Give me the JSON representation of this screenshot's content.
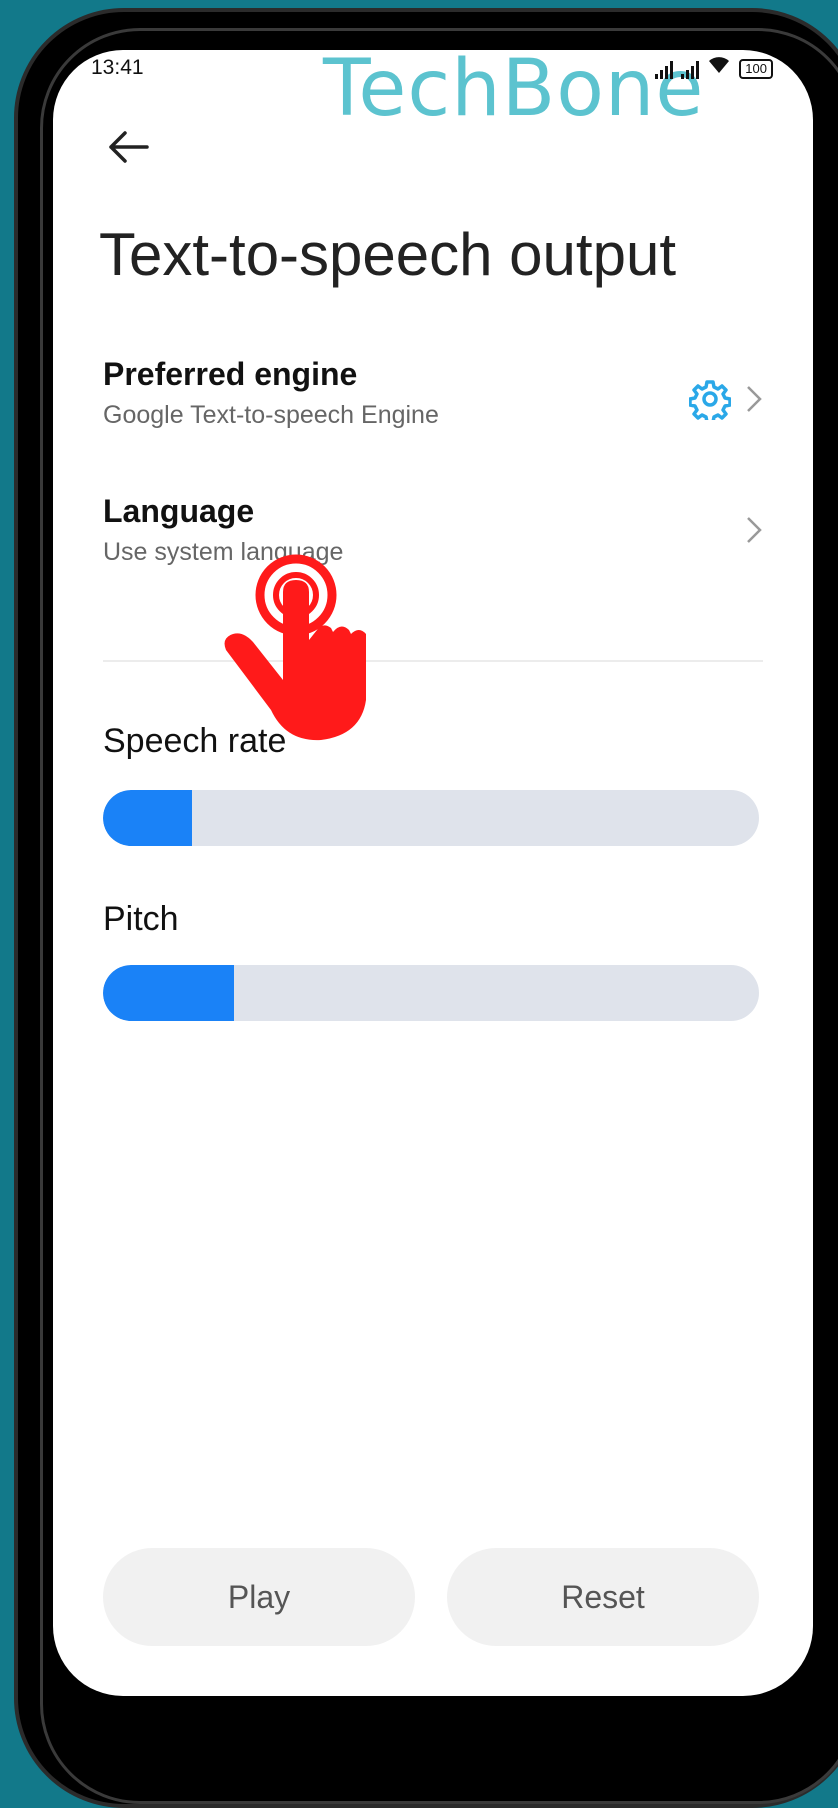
{
  "status_bar": {
    "time": "13:41",
    "battery": "100"
  },
  "watermark": "TechBone",
  "page": {
    "title": "Text-to-speech output"
  },
  "settings": [
    {
      "title": "Preferred engine",
      "subtitle": "Google Text-to-speech Engine"
    },
    {
      "title": "Language",
      "subtitle": "Use system language"
    }
  ],
  "speech_rate": {
    "label": "Speech rate",
    "value": 0.135
  },
  "pitch": {
    "label": "Pitch",
    "value": 0.2
  },
  "buttons": {
    "play": "Play",
    "reset": "Reset"
  },
  "colors": {
    "accent": "#1a82f7",
    "track": "#dfe3eb",
    "gear": "#2aa8e8",
    "tap_indicator": "#ff1a1a"
  },
  "icons": [
    "back-arrow-icon",
    "gear-icon",
    "chevron-right-icon",
    "signal-icon",
    "wifi-icon",
    "battery-icon",
    "tap-hand-icon"
  ]
}
